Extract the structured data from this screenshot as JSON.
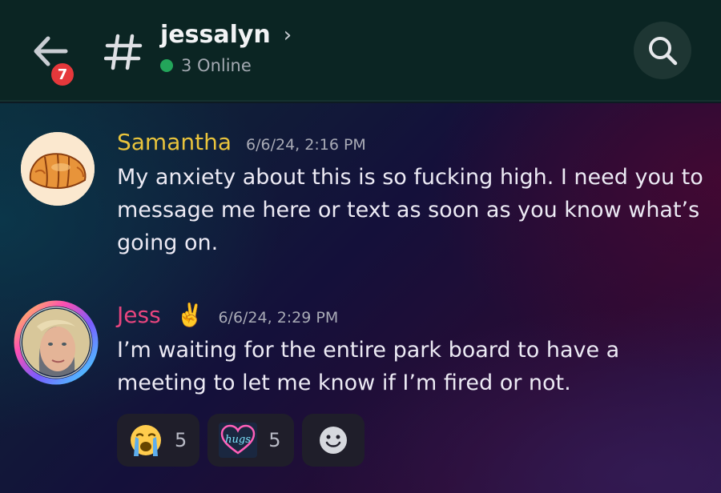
{
  "header": {
    "unread_count": "7",
    "channel_name": "jessalyn",
    "chevron": "›",
    "online_text": "3 Online"
  },
  "icons": {
    "back": "back-arrow-icon",
    "hash": "hash-icon",
    "search": "search-icon",
    "add_reaction": "smiley-icon"
  },
  "colors": {
    "header_bg": "#0b2523",
    "online_dot": "#23a55a",
    "badge": "#e5383b",
    "samantha_name": "#e9c43c",
    "jess_name": "#e8457e"
  },
  "messages": [
    {
      "author": "Samantha",
      "timestamp": "6/6/24, 2:16 PM",
      "text": "My anxiety about this is so fucking high. I need you to message me here or text as soon as you know what’s going on."
    },
    {
      "author": "Jess",
      "author_emoji": "✌️",
      "timestamp": "6/6/24, 2:29 PM",
      "text": "I’m waiting for the entire park board to have a meeting to let me know if I’m fired or not."
    }
  ],
  "reactions": [
    {
      "emoji": "😭",
      "count": "5"
    },
    {
      "emoji": "hugs",
      "count": "5"
    }
  ]
}
